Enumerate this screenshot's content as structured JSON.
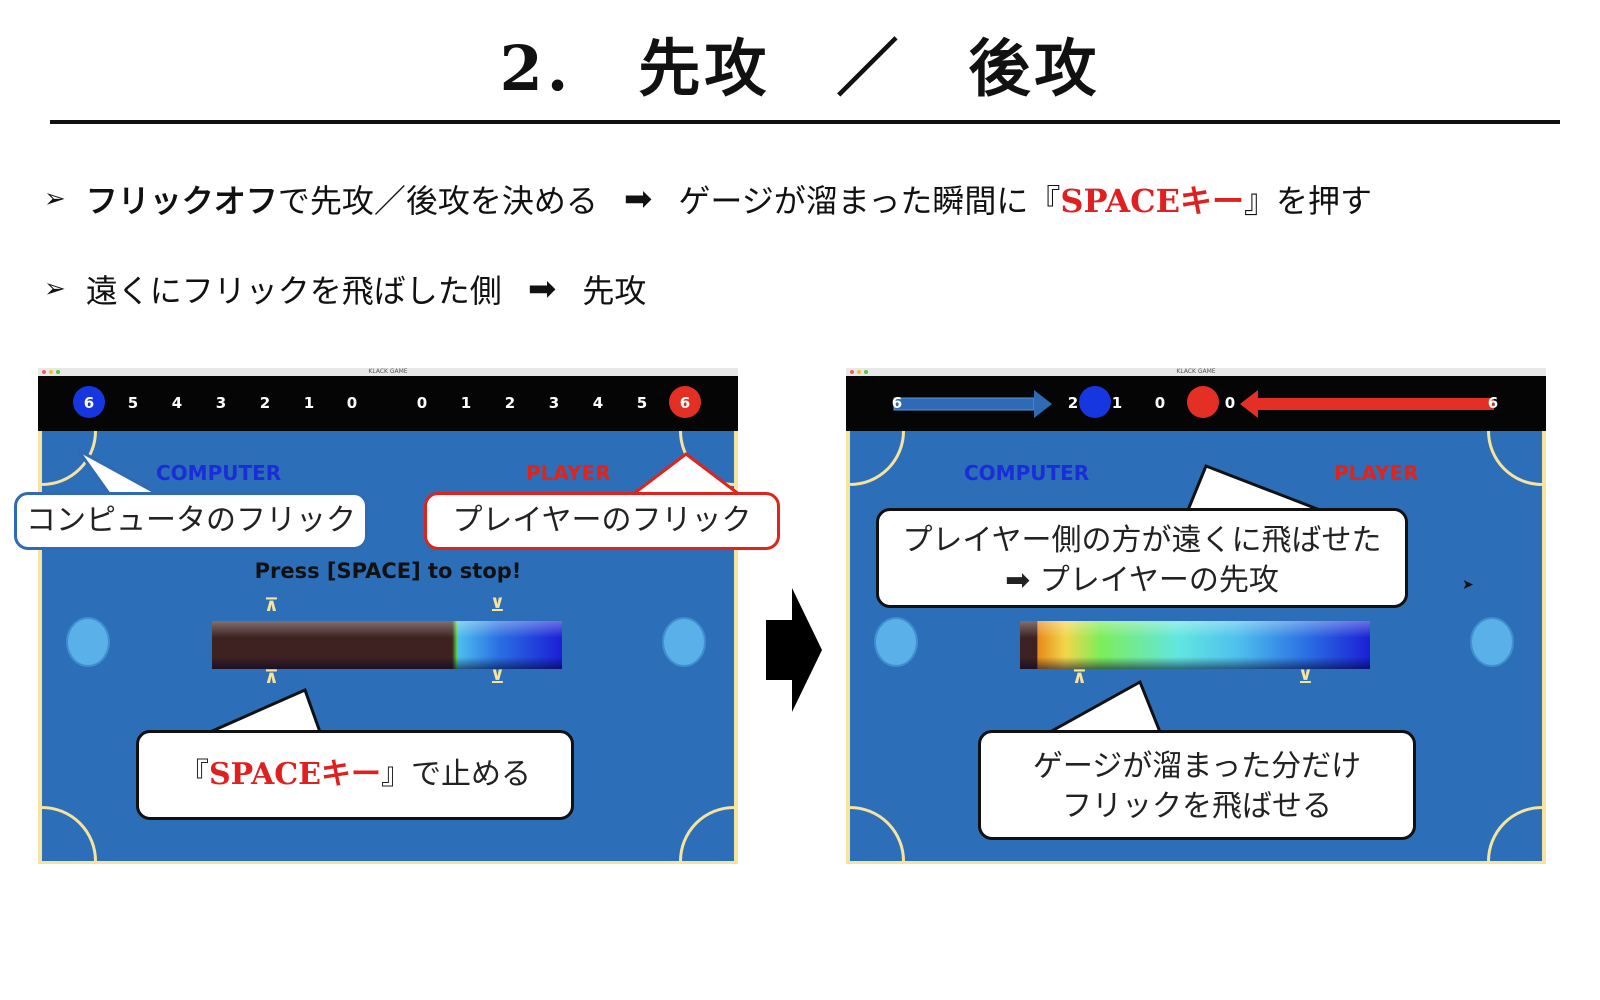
{
  "title": "2.　先攻　／　後攻",
  "bullets": [
    {
      "parts": {
        "bold": "フリックオフ",
        "text1": "で先攻／後攻を決める",
        "text2": "ゲージが溜まった瞬間に『",
        "red": "SPACEキー",
        "text3": "』を押す"
      }
    },
    {
      "parts": {
        "text1": "遠くにフリックを飛ばした側",
        "text2": "先攻"
      }
    }
  ],
  "window_title": "KLACK GAME",
  "left_screen": {
    "computer_scores": [
      "6",
      "5",
      "4",
      "3",
      "2",
      "1",
      "0"
    ],
    "player_scores": [
      "0",
      "1",
      "2",
      "3",
      "4",
      "5",
      "6"
    ],
    "computer_label": "COMPUTER",
    "player_label": "PLAYER",
    "press_text": "Press [SPACE] to stop!",
    "gauge_fill_fraction": 0.3
  },
  "right_screen": {
    "scores_visible": [
      "6",
      "2",
      "1",
      "0",
      "0",
      "6"
    ],
    "computer_label": "COMPUTER",
    "player_label": "PLAYER",
    "gauge_fill_fraction": 0.95
  },
  "callouts": {
    "computer_flick": "コンピュータのフリック",
    "player_flick": "プレイヤーのフリック",
    "space_stop_red": "SPACEキー",
    "space_stop_pre": "『",
    "space_stop_post": "』で止める",
    "result_line1": "プレイヤー側の方が遠くに飛ばせた",
    "result_line2": "➡ プレイヤーの先攻",
    "gauge_line1": "ゲージが溜まった分だけ",
    "gauge_line2": "フリックを飛ばせる"
  },
  "arrow_glyph": "➡",
  "bullet_glyph": "➢",
  "colors": {
    "computer_blue": "#1a2ed8",
    "player_red": "#e0241c",
    "board_blue": "#2d6eb8",
    "board_border": "#f6e39d"
  }
}
